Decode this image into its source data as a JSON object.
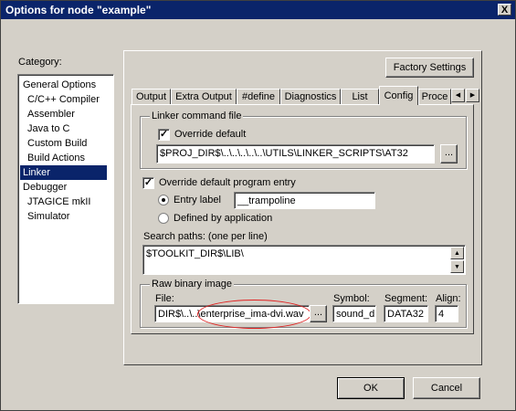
{
  "window": {
    "title": "Options for node \"example\"",
    "close_label": "X"
  },
  "category": {
    "label": "Category:",
    "items": [
      "General Options",
      "C/C++ Compiler",
      "Assembler",
      "Java to C",
      "Custom Build",
      "Build Actions",
      "Linker",
      "Debugger",
      "JTAGICE mkII",
      "Simulator"
    ],
    "selected": "Linker"
  },
  "factory_settings_label": "Factory Settings",
  "tabs": [
    "Output",
    "Extra Output",
    "#define",
    "Diagnostics",
    "List",
    "Config",
    "Proce"
  ],
  "active_tab": "Config",
  "tab_scroll": {
    "left": "◀",
    "right": "▶"
  },
  "linker_cmd": {
    "group_title": "Linker command file",
    "override_label": "Override default",
    "override_checked": "✓",
    "path": "$PROJ_DIR$\\..\\..\\..\\..\\..\\UTILS\\LINKER_SCRIPTS\\AT32",
    "browse_label": "..."
  },
  "entry": {
    "override_label": "Override default program entry",
    "override_checked": "✓",
    "entry_label_text": "Entry label",
    "entry_label_value": "__trampoline",
    "defined_by_app": "Defined by application"
  },
  "search_paths": {
    "label": "Search paths:  (one per line)",
    "value": "$TOOLKIT_DIR$\\LIB\\"
  },
  "raw_binary": {
    "group_title": "Raw binary image",
    "file_label": "File:",
    "file_value": "DIR$\\..\\..\\enterprise_ima-dvi.wav",
    "browse_label": "...",
    "symbol_label": "Symbol:",
    "symbol_value": "sound_d",
    "segment_label": "Segment:",
    "segment_value": "DATA32",
    "align_label": "Align:",
    "align_value": "4"
  },
  "buttons": {
    "ok": "OK",
    "cancel": "Cancel"
  }
}
